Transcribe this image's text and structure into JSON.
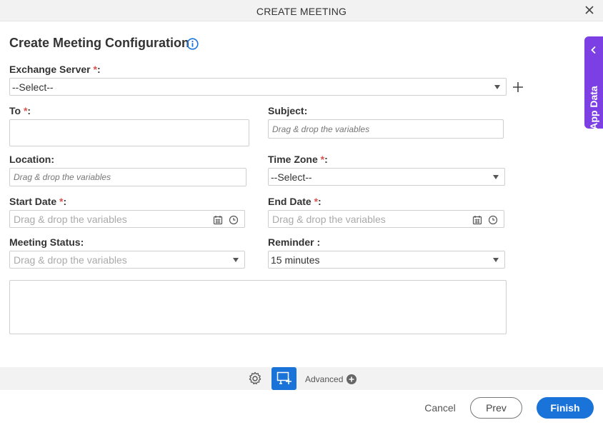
{
  "window": {
    "title": "CREATE MEETING"
  },
  "heading": "Create Meeting Configuration",
  "required_mark": "*",
  "fields": {
    "exchange_server": {
      "label": "Exchange Server ",
      "suffix": ":",
      "value": "--Select--"
    },
    "to": {
      "label": "To ",
      "suffix": ":"
    },
    "subject": {
      "label": "Subject:",
      "placeholder": "Drag & drop the variables"
    },
    "location": {
      "label": "Location:",
      "placeholder": "Drag & drop the variables"
    },
    "time_zone": {
      "label": "Time Zone ",
      "suffix": ":",
      "value": "--Select--"
    },
    "start_date": {
      "label": "Start Date ",
      "suffix": ":",
      "placeholder": "Drag & drop the variables"
    },
    "end_date": {
      "label": "End Date ",
      "suffix": ":",
      "placeholder": "Drag & drop the variables"
    },
    "meeting_status": {
      "label": "Meeting Status:",
      "placeholder": "Drag & drop the variables"
    },
    "reminder": {
      "label": "Reminder :",
      "value": "15 minutes"
    }
  },
  "side_panel": {
    "label": "App Data"
  },
  "toolbar": {
    "advanced_label": "Advanced"
  },
  "footer": {
    "cancel": "Cancel",
    "prev": "Prev",
    "finish": "Finish"
  },
  "colors": {
    "primary": "#1a73d9",
    "side_panel": "#7b3fe4",
    "required": "#d9534f"
  }
}
